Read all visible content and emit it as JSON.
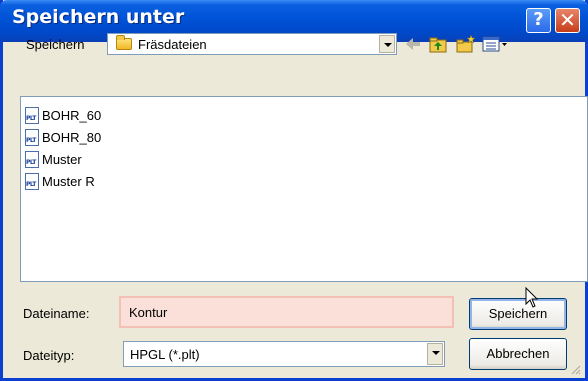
{
  "window": {
    "title": "Speichern unter",
    "help_glyph": "?",
    "close_glyph": "✕"
  },
  "location": {
    "label": "Speichern",
    "folder": "Fräsdateien"
  },
  "files": [
    {
      "name": "BOHR_60",
      "icon": "plt-file-icon"
    },
    {
      "name": "BOHR_80",
      "icon": "plt-file-icon"
    },
    {
      "name": "Muster",
      "icon": "plt-file-icon"
    },
    {
      "name": "Muster R",
      "icon": "plt-file-icon"
    }
  ],
  "file_icon_text": "PLT",
  "filename": {
    "label": "Dateiname:",
    "value": "Kontur"
  },
  "filetype": {
    "label": "Dateityp:",
    "value": "HPGL (*.plt)"
  },
  "buttons": {
    "save": "Speichern",
    "cancel": "Abbrechen"
  },
  "colors": {
    "titlebar": "#0052d6",
    "dialog_bg": "#ece9d8",
    "filename_highlight": "#fbdfd9"
  }
}
